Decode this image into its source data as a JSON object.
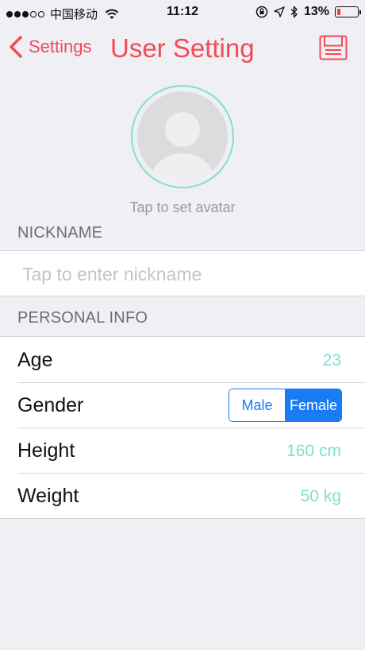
{
  "status_bar": {
    "carrier": "中国移动",
    "time": "11:12",
    "battery_percent": "13%",
    "battery_level": 0.13,
    "icons": [
      "signal-dots-icon",
      "wifi-icon",
      "orientation-lock-icon",
      "location-arrow-icon",
      "bluetooth-icon",
      "battery-icon"
    ]
  },
  "nav": {
    "back_label": "Settings",
    "title": "User Setting",
    "accent_color": "#f24b57"
  },
  "avatar": {
    "caption": "Tap to set avatar",
    "ring_color": "#7ee0cf"
  },
  "nickname": {
    "header": "NICKNAME",
    "placeholder": "Tap to enter nickname",
    "value": ""
  },
  "personal_info": {
    "header": "PERSONAL INFO",
    "rows": [
      {
        "label": "Age",
        "value": "23"
      },
      {
        "label": "Gender",
        "options": [
          "Male",
          "Female"
        ],
        "selected": "Female"
      },
      {
        "label": "Height",
        "value": "160 cm"
      },
      {
        "label": "Weight",
        "value": "50 kg"
      }
    ],
    "value_color": "#7ee0cf",
    "segment_color": "#1a7cf5"
  }
}
